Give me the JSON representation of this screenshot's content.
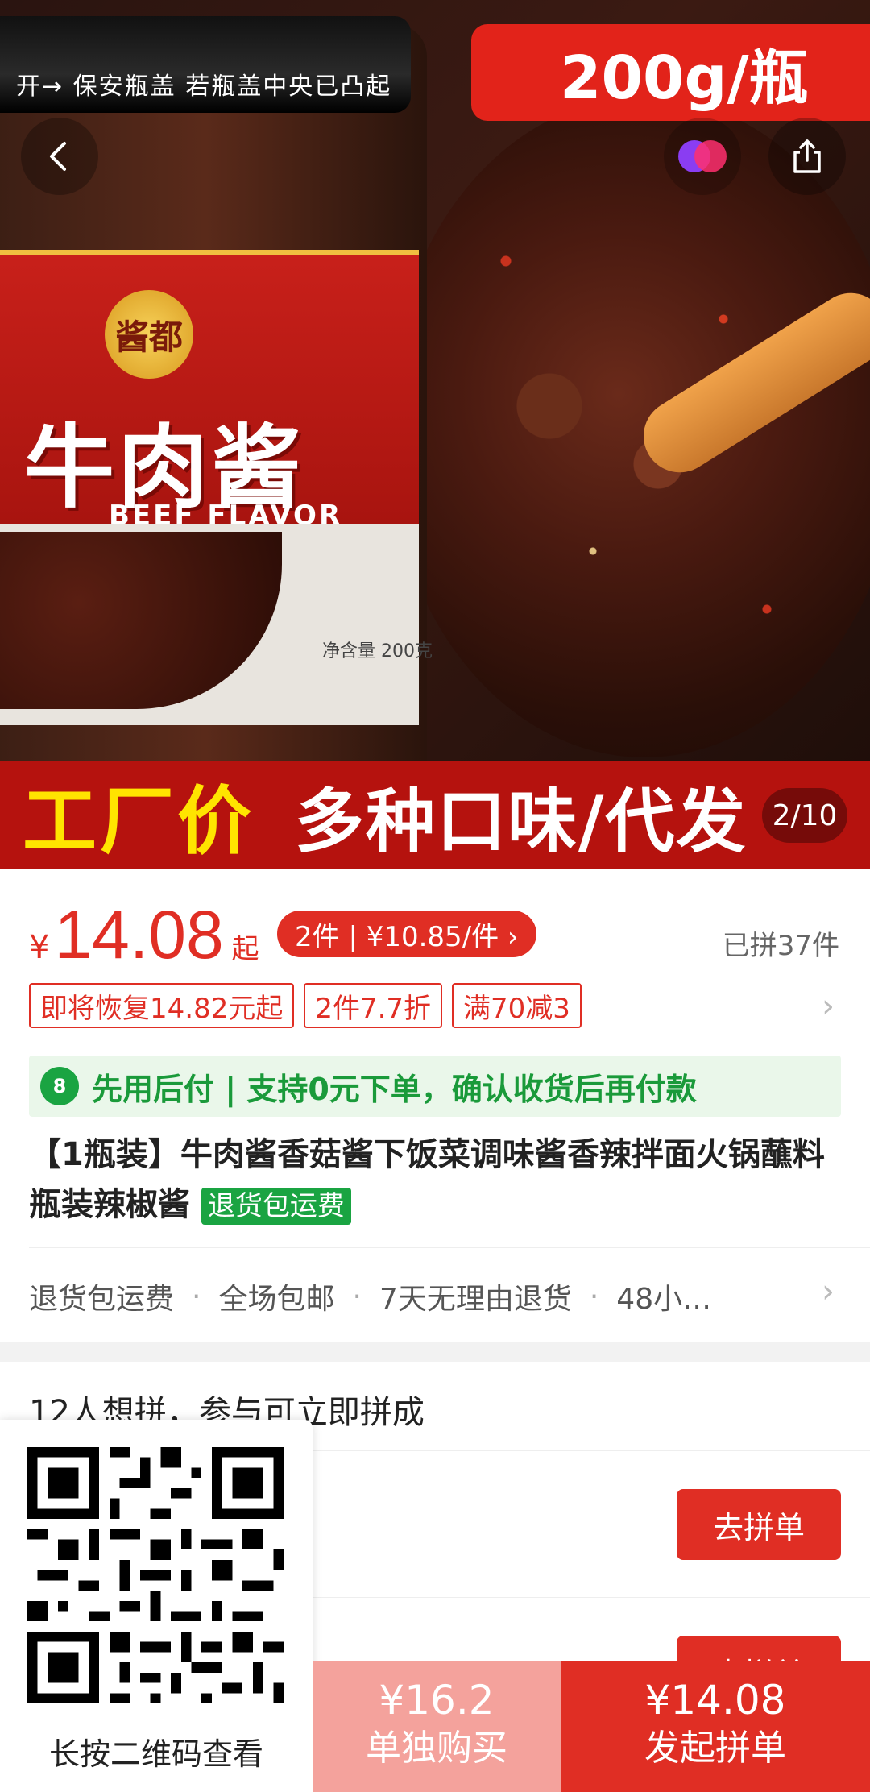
{
  "hero": {
    "lid_text": "开→    保安瓶盖  若瓶盖中央已凸起",
    "top_banner": "200g/瓶",
    "brand": "酱都",
    "jar_cn": "牛肉酱",
    "jar_en": "BEEF FLAVOR",
    "net_weight": "净含量 200克",
    "banner_yellow": "工厂价",
    "banner_white": "多种口味/代发",
    "counter": "2/10"
  },
  "nav": {
    "back_icon": "back-arrow-icon",
    "share_icon": "share-icon",
    "avatar_icon": "avatar-icon"
  },
  "price": {
    "symbol": "¥",
    "value": "14.08",
    "suffix": "起",
    "multi_pill": "2件 | ¥10.85/件 ›",
    "sold": "已拼37件"
  },
  "tags": [
    "即将恢复14.82元起",
    "2件7.7折",
    "满70减3"
  ],
  "pay_later": {
    "icon_text": "8",
    "text": "先用后付 | 支持0元下单，确认收货后再付款"
  },
  "title": {
    "text": "【1瓶装】牛肉酱香菇酱下饭菜调味酱香辣拌面火锅蘸料瓶装辣椒酱",
    "badge": "退货包运费"
  },
  "services": [
    "退货包运费",
    "全场包邮",
    "7天无理由退货",
    "48小…"
  ],
  "group": {
    "header": "12人想拼，参与可立即拼成",
    "join_label": "去拼单"
  },
  "qr": {
    "caption": "长按二维码查看"
  },
  "bottom_bar": {
    "single_price": "¥16.2",
    "single_label": "单独购买",
    "group_price": "¥14.08",
    "group_label": "发起拼单"
  },
  "colors": {
    "accent": "#e02e24",
    "green": "#1aa442",
    "single_bg": "#f4a29c"
  }
}
